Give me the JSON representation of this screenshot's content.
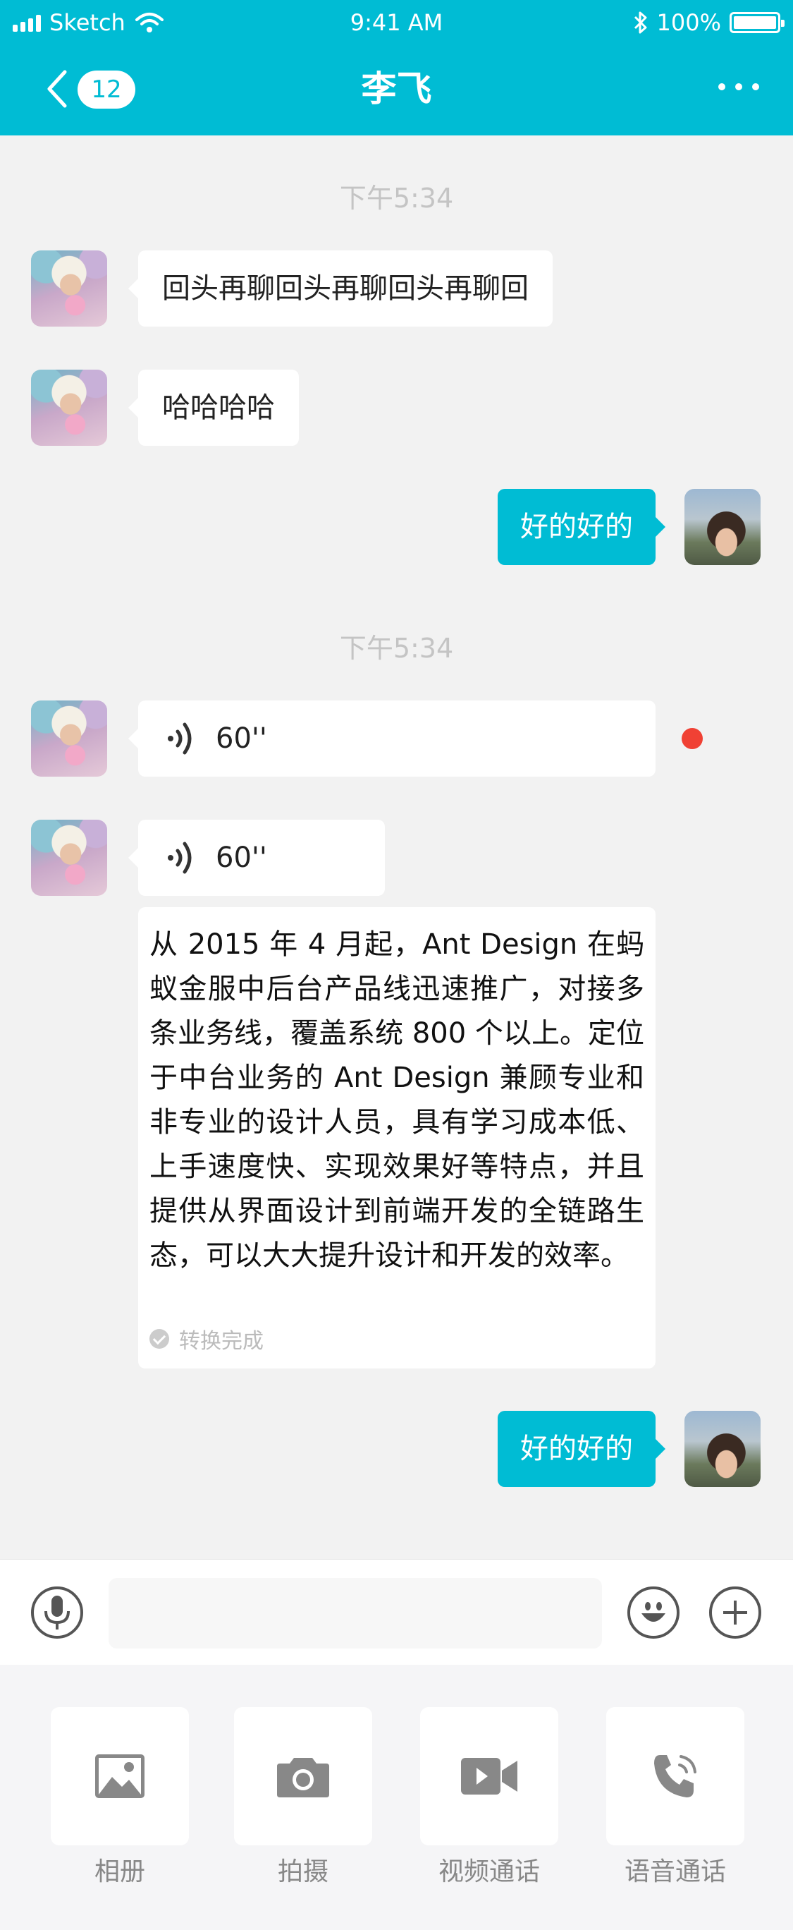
{
  "status_bar": {
    "carrier": "Sketch",
    "time": "9:41 AM",
    "battery": "100%"
  },
  "nav": {
    "badge_count": "12",
    "title": "李飞"
  },
  "messages": [
    {
      "type": "timestamp",
      "text": "下午5:34"
    },
    {
      "type": "text",
      "side": "left",
      "text": "回头再聊回头再聊回头再聊回"
    },
    {
      "type": "text",
      "side": "left",
      "text": "哈哈哈哈"
    },
    {
      "type": "text",
      "side": "right",
      "text": "好的好的"
    },
    {
      "type": "timestamp",
      "text": "下午5:34"
    },
    {
      "type": "voice",
      "side": "left",
      "duration": "60''",
      "unread": true
    },
    {
      "type": "voice",
      "side": "left",
      "duration": "60''",
      "unread": false
    },
    {
      "type": "transcript",
      "text": "从 2015 年 4 月起，Ant Design 在蚂蚁金服中后台产品线迅速推广，对接多条业务线，覆盖系统 800 个以上。定位于中台业务的 Ant Design 兼顾专业和非专业的设计人员，具有学习成本低、上手速度快、实现效果好等特点，并且提供从界面设计到前端开发的全链路生态，可以大大提升设计和开发的效率。",
      "status": "转换完成"
    },
    {
      "type": "text",
      "side": "right",
      "text": "好的好的"
    }
  ],
  "input": {
    "placeholder": "",
    "value": ""
  },
  "tools": [
    {
      "label": "相册",
      "icon": "image-icon"
    },
    {
      "label": "拍摄",
      "icon": "camera-icon"
    },
    {
      "label": "视频通话",
      "icon": "video-icon"
    },
    {
      "label": "语音通话",
      "icon": "phone-icon"
    }
  ],
  "colors": {
    "brand": "#00bcd4",
    "unread": "#f04134",
    "background": "#f2f2f2"
  }
}
